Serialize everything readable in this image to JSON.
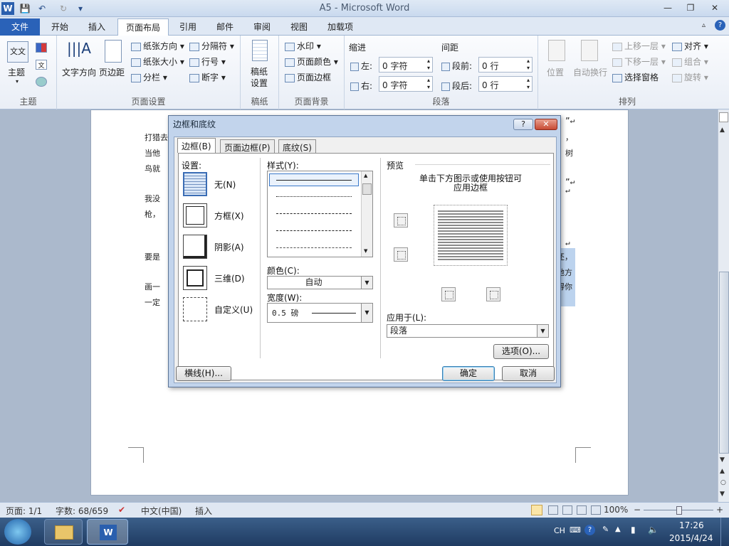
{
  "window": {
    "title": "A5 - Microsoft Word",
    "minimize": "—",
    "restore": "❐",
    "close": "✕"
  },
  "quick_access": {
    "app_icon": "W",
    "save": "💾",
    "undo": "↶",
    "redo": "↻",
    "customize": "▾"
  },
  "tabs": [
    "文件",
    "开始",
    "插入",
    "页面布局",
    "引用",
    "邮件",
    "审阅",
    "视图",
    "加载项"
  ],
  "active_tab": "页面布局",
  "ribbon": {
    "theme_group": {
      "label": "主题",
      "button": "主题",
      "icon_text": "文文"
    },
    "page_setup": {
      "label": "页面设置",
      "text_direction": "文字方向",
      "margins": "页边距",
      "orientation": "纸张方向",
      "size": "纸张大小",
      "columns": "分栏",
      "breaks": "分隔符",
      "line_numbers": "行号",
      "hyphenation": "断字"
    },
    "manuscript": {
      "label": "稿纸",
      "button_l1": "稿纸",
      "button_l2": "设置"
    },
    "page_background": {
      "label": "页面背景",
      "watermark": "水印",
      "page_color": "页面颜色",
      "page_borders": "页面边框"
    },
    "paragraph": {
      "label": "段落",
      "indent_title": "缩进",
      "spacing_title": "间距",
      "left": "左:",
      "right": "右:",
      "before": "段前:",
      "after": "段后:",
      "left_value": "0 字符",
      "right_value": "0 字符",
      "before_value": "0 行",
      "after_value": "0 行"
    },
    "arrange": {
      "label": "排列",
      "position": "位置",
      "wrap": "自动换行",
      "bring_forward": "上移一层",
      "send_backward": "下移一层",
      "selection_pane": "选择窗格",
      "align": "对齐",
      "group": "组合",
      "rotate": "旋转"
    }
  },
  "document": {
    "lines": [
      {
        "text": "打猎去",
        "right": "”↵"
      },
      {
        "text": "当他",
        "right": "，"
      },
      {
        "text": "鸟就",
        "right": "树"
      },
      {
        "text": "",
        "right": "”↵"
      },
      {
        "text": "我没",
        "right": ""
      },
      {
        "text": "枪，",
        "right": ""
      },
      {
        "text": "要是",
        "right": "还，"
      },
      {
        "text": "画一",
        "right": "地方"
      },
      {
        "text": "一定",
        "right": "得你"
      }
    ],
    "return_mark": "↵"
  },
  "dialog": {
    "title": "边框和底纹",
    "help": "?",
    "close": "✕",
    "tabs": [
      "边框(B)",
      "页面边框(P)",
      "底纹(S)"
    ],
    "settings_label": "设置:",
    "settings": [
      "无(N)",
      "方框(X)",
      "阴影(A)",
      "三维(D)",
      "自定义(U)"
    ],
    "style_label": "样式(Y):",
    "color_label": "颜色(C):",
    "color_value": "自动",
    "width_label": "宽度(W):",
    "width_value": "0.5 磅",
    "preview_label": "预览",
    "preview_hint_1": "单击下方图示或使用按钮可",
    "preview_hint_2": "应用边框",
    "apply_to_label": "应用于(L):",
    "apply_to_value": "段落",
    "options_button": "选项(O)...",
    "horizontal_line_button": "横线(H)...",
    "ok_button": "确定",
    "cancel_button": "取消"
  },
  "status": {
    "page": "页面: 1/1",
    "words": "字数: 68/659",
    "language": "中文(中国)",
    "mode": "插入",
    "zoom": "100%",
    "zoom_minus": "−",
    "zoom_plus": "+"
  },
  "taskbar": {
    "ime": "CH",
    "time": "17:26",
    "date": "2015/4/24"
  }
}
